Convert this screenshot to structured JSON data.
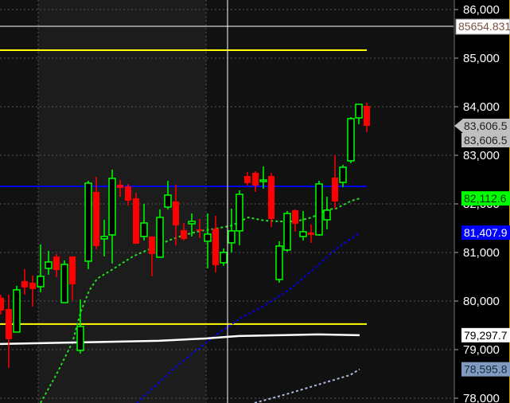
{
  "chart_data": {
    "type": "candlestick",
    "title": "",
    "xlabel": "",
    "ylabel": "",
    "ylim": [
      77900,
      86200
    ],
    "y_ticks": [
      "78,000",
      "79,000",
      "80,000",
      "81,000",
      "82,000",
      "83,000",
      "84,000",
      "85,000",
      "86,000"
    ],
    "y_tick_values": [
      78000,
      79000,
      80000,
      81000,
      82000,
      83000,
      84000,
      85000,
      86000
    ],
    "grid": true,
    "colors": {
      "up": "#00ff00",
      "down": "#ff0000",
      "background": "#111111",
      "highlight_band": "#1c1c1c",
      "axis_bg": "#000000"
    },
    "candles": [
      {
        "o": 80067,
        "h": 80133,
        "l": 79722,
        "c": 79805
      },
      {
        "o": 79837,
        "h": 80133,
        "l": 78624,
        "c": 79215
      },
      {
        "o": 79362,
        "h": 80313,
        "l": 79362,
        "c": 80231
      },
      {
        "o": 80411,
        "h": 80657,
        "l": 80133,
        "c": 80280
      },
      {
        "o": 80378,
        "h": 80526,
        "l": 79887,
        "c": 80247
      },
      {
        "o": 80296,
        "h": 81165,
        "l": 80182,
        "c": 80509
      },
      {
        "o": 80673,
        "h": 81034,
        "l": 80542,
        "c": 80804
      },
      {
        "o": 80919,
        "h": 80968,
        "l": 80493,
        "c": 80640
      },
      {
        "o": 79968,
        "h": 80837,
        "l": 79968,
        "c": 80755
      },
      {
        "o": 80919,
        "h": 80919,
        "l": 80018,
        "c": 80345
      },
      {
        "o": 78985,
        "h": 80034,
        "l": 78920,
        "c": 79477
      },
      {
        "o": 80821,
        "h": 82476,
        "l": 80657,
        "c": 82427
      },
      {
        "o": 82247,
        "h": 82558,
        "l": 81067,
        "c": 81132
      },
      {
        "o": 81280,
        "h": 81673,
        "l": 80919,
        "c": 81329
      },
      {
        "o": 81362,
        "h": 82706,
        "l": 80772,
        "c": 82525
      },
      {
        "o": 82394,
        "h": 82493,
        "l": 82148,
        "c": 82329
      },
      {
        "o": 82361,
        "h": 82411,
        "l": 81968,
        "c": 82066
      },
      {
        "o": 82115,
        "h": 82230,
        "l": 81181,
        "c": 81181
      },
      {
        "o": 81329,
        "h": 82001,
        "l": 81247,
        "c": 81607
      },
      {
        "o": 81329,
        "h": 81329,
        "l": 80509,
        "c": 80968
      },
      {
        "o": 80903,
        "h": 81886,
        "l": 80903,
        "c": 81722
      },
      {
        "o": 81935,
        "h": 82476,
        "l": 81886,
        "c": 82181
      },
      {
        "o": 82050,
        "h": 82394,
        "l": 81149,
        "c": 81558
      },
      {
        "o": 81460,
        "h": 81607,
        "l": 81247,
        "c": 81280
      },
      {
        "o": 81591,
        "h": 81804,
        "l": 81329,
        "c": 81640
      },
      {
        "o": 81476,
        "h": 81689,
        "l": 81296,
        "c": 81444
      },
      {
        "o": 81231,
        "h": 81804,
        "l": 80673,
        "c": 81378
      },
      {
        "o": 81493,
        "h": 81755,
        "l": 80591,
        "c": 80739
      },
      {
        "o": 80788,
        "h": 81083,
        "l": 80722,
        "c": 81001
      },
      {
        "o": 81198,
        "h": 81902,
        "l": 81001,
        "c": 81444
      },
      {
        "o": 81444,
        "h": 82279,
        "l": 81149,
        "c": 82198
      },
      {
        "o": 82574,
        "h": 82656,
        "l": 82378,
        "c": 82427
      },
      {
        "o": 82640,
        "h": 82673,
        "l": 82247,
        "c": 82378
      },
      {
        "o": 82460,
        "h": 82771,
        "l": 82312,
        "c": 82493
      },
      {
        "o": 82574,
        "h": 82640,
        "l": 81526,
        "c": 81689
      },
      {
        "o": 80444,
        "h": 81231,
        "l": 80378,
        "c": 81132
      },
      {
        "o": 81050,
        "h": 81853,
        "l": 81017,
        "c": 81804
      },
      {
        "o": 81870,
        "h": 81886,
        "l": 81427,
        "c": 81591
      },
      {
        "o": 81329,
        "h": 81853,
        "l": 81247,
        "c": 81427
      },
      {
        "o": 81411,
        "h": 81575,
        "l": 81198,
        "c": 81362
      },
      {
        "o": 81362,
        "h": 82476,
        "l": 81345,
        "c": 82411
      },
      {
        "o": 81673,
        "h": 82148,
        "l": 81476,
        "c": 81870
      },
      {
        "o": 82542,
        "h": 83001,
        "l": 81902,
        "c": 82050
      },
      {
        "o": 82443,
        "h": 82804,
        "l": 82345,
        "c": 82755
      },
      {
        "o": 82886,
        "h": 83787,
        "l": 82837,
        "c": 83755
      },
      {
        "o": 83771,
        "h": 84066,
        "l": 83640,
        "c": 84050
      },
      {
        "o": 84017,
        "h": 84083,
        "l": 83476,
        "c": 83607
      }
    ],
    "horizontal_lines": [
      {
        "name": "yellow-upper",
        "value": 85164,
        "color": "#ffff00"
      },
      {
        "name": "blue-level",
        "value": 82361,
        "color": "#0000ff"
      },
      {
        "name": "yellow-lower",
        "value": 79526,
        "color": "#ffff00"
      }
    ],
    "moving_averages": [
      {
        "name": "green-ma",
        "color": "#22dd22",
        "style": "dotted",
        "points": [
          [
            5,
            77903
          ],
          [
            7,
            78493
          ],
          [
            9,
            79149
          ],
          [
            10.1,
            79804
          ],
          [
            11.1,
            80214
          ],
          [
            12.1,
            80460
          ],
          [
            14.1,
            80657
          ],
          [
            16.6,
            80919
          ],
          [
            19.1,
            81099
          ],
          [
            21.1,
            81247
          ],
          [
            23.1,
            81362
          ],
          [
            25.1,
            81444
          ],
          [
            27.1,
            81493
          ],
          [
            29.1,
            81558
          ],
          [
            31.1,
            81722
          ],
          [
            33.1,
            81657
          ],
          [
            35.1,
            81640
          ],
          [
            37.1,
            81640
          ],
          [
            39.1,
            81722
          ],
          [
            41.1,
            81886
          ],
          [
            42.1,
            81902
          ],
          [
            44.1,
            82066
          ],
          [
            45.1,
            82112.6
          ]
        ]
      },
      {
        "name": "blue-ma",
        "color": "#0000ee",
        "style": "dotted",
        "points": [
          [
            17.1,
            77903
          ],
          [
            22.1,
            78657
          ],
          [
            27.1,
            79313
          ],
          [
            30.1,
            79641
          ],
          [
            33.1,
            79903
          ],
          [
            36.1,
            80214
          ],
          [
            39.1,
            80624
          ],
          [
            42.1,
            81067
          ],
          [
            45.1,
            81407.9
          ]
        ]
      },
      {
        "name": "white-ma",
        "color": "#ffffff",
        "style": "solid",
        "points": [
          [
            -0.1,
            79116
          ],
          [
            9.9,
            79149
          ],
          [
            19.9,
            79182
          ],
          [
            25.9,
            79231
          ],
          [
            29.9,
            79280
          ],
          [
            39.9,
            79313
          ],
          [
            45.1,
            79297.7
          ]
        ]
      },
      {
        "name": "lightblue-ma",
        "color": "#aabbdd",
        "style": "dotted",
        "points": [
          [
            31.9,
            77903
          ],
          [
            35.9,
            78083
          ],
          [
            39.9,
            78280
          ],
          [
            43.9,
            78477
          ],
          [
            45.1,
            78595.8
          ]
        ]
      }
    ],
    "crosshair": {
      "price_label": "85654.831",
      "value": 85654.831,
      "candle_index": 28.5
    },
    "price_tags": [
      {
        "label": "83,606.5",
        "value": 83606.5,
        "bg": "#c0c0c0",
        "fg": "#222222",
        "arrow": true,
        "offset": 0
      },
      {
        "label": "83,606.5",
        "value": 83606.5,
        "bg": "#c0c0c0",
        "fg": "#222222",
        "arrow": false,
        "offset": 18
      },
      {
        "label": "82,112.6",
        "value": 82112.6,
        "bg": "#00ff00",
        "fg": "#003300",
        "arrow": false,
        "offset": 0
      },
      {
        "label": "81,407.9",
        "value": 81407.9,
        "bg": "#0000ff",
        "fg": "#ffffff",
        "arrow": false,
        "offset": 0
      },
      {
        "label": "79,297.7",
        "value": 79297.7,
        "bg": "#ffffff",
        "fg": "#000000",
        "arrow": false,
        "offset": 0
      },
      {
        "label": "78,595.8",
        "value": 78595.8,
        "bg": "#7f9cc0",
        "fg": "#1a2a40",
        "arrow": false,
        "offset": 0
      }
    ]
  }
}
